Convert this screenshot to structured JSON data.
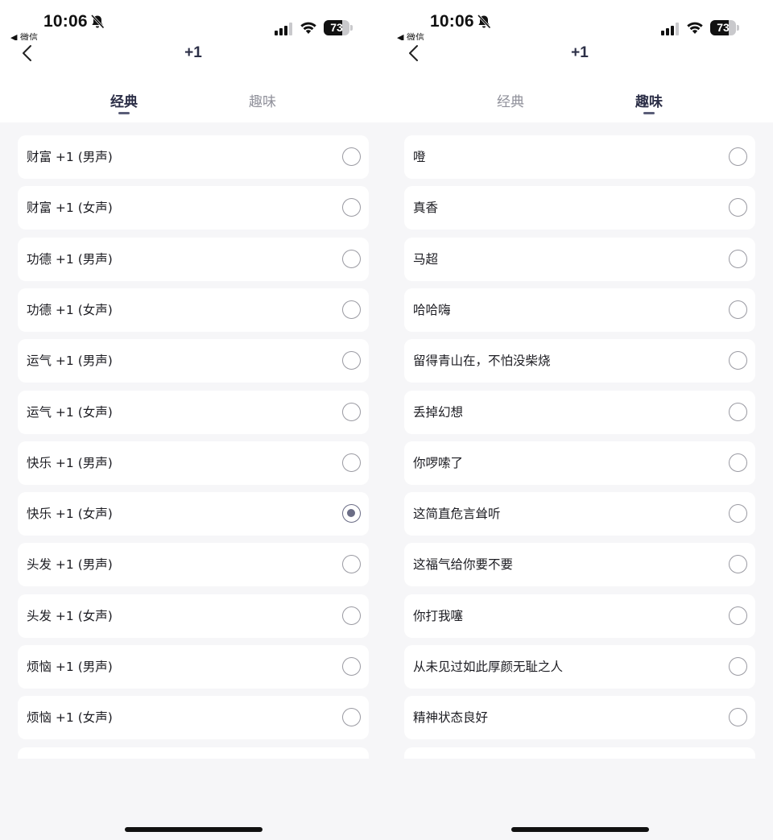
{
  "screens": [
    {
      "status": {
        "time": "10:06",
        "back_app": "◀ 微信",
        "battery_level": "73"
      },
      "nav": {
        "title": "+1"
      },
      "tabs": [
        {
          "label": "经典",
          "active": true
        },
        {
          "label": "趣味",
          "active": false
        }
      ],
      "items": [
        {
          "label": "财富 +1 (男声)",
          "selected": false
        },
        {
          "label": "财富 +1 (女声)",
          "selected": false
        },
        {
          "label": "功德 +1 (男声)",
          "selected": false
        },
        {
          "label": "功德 +1 (女声)",
          "selected": false
        },
        {
          "label": "运气 +1 (男声)",
          "selected": false
        },
        {
          "label": "运气 +1 (女声)",
          "selected": false
        },
        {
          "label": "快乐 +1 (男声)",
          "selected": false
        },
        {
          "label": "快乐 +1 (女声)",
          "selected": true
        },
        {
          "label": "头发 +1 (男声)",
          "selected": false
        },
        {
          "label": "头发 +1 (女声)",
          "selected": false
        },
        {
          "label": "烦恼 +1 (男声)",
          "selected": false
        },
        {
          "label": "烦恼 +1 (女声)",
          "selected": false
        }
      ]
    },
    {
      "status": {
        "time": "10:06",
        "back_app": "◀ 微信",
        "battery_level": "73"
      },
      "nav": {
        "title": "+1"
      },
      "tabs": [
        {
          "label": "经典",
          "active": false
        },
        {
          "label": "趣味",
          "active": true
        }
      ],
      "items": [
        {
          "label": "噔",
          "selected": false
        },
        {
          "label": "真香",
          "selected": false
        },
        {
          "label": "马超",
          "selected": false
        },
        {
          "label": "哈哈嗨",
          "selected": false
        },
        {
          "label": "留得青山在，不怕没柴烧",
          "selected": false
        },
        {
          "label": "丢掉幻想",
          "selected": false
        },
        {
          "label": "你啰嗦了",
          "selected": false
        },
        {
          "label": "这简直危言耸听",
          "selected": false
        },
        {
          "label": "这福气给你要不要",
          "selected": false
        },
        {
          "label": "你打我噻",
          "selected": false
        },
        {
          "label": "从未见过如此厚颜无耻之人",
          "selected": false
        },
        {
          "label": "精神状态良好",
          "selected": false
        }
      ]
    }
  ],
  "icons": {
    "bell_slash": "bell-slash-icon",
    "signal": "cellular-signal-icon",
    "wifi": "wifi-icon",
    "battery": "battery-icon",
    "back": "chevron-left-icon",
    "radio": "radio-button-icon"
  },
  "colors": {
    "accent": "#5a5d78",
    "radio_checked": "#6b6d86",
    "background": "#f6f6f8",
    "card": "#ffffff"
  }
}
